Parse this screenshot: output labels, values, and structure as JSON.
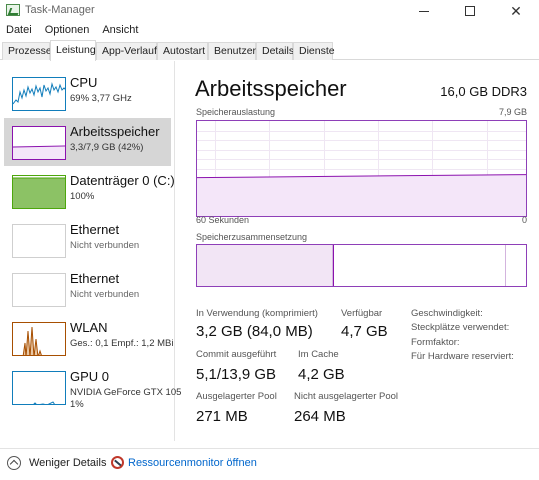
{
  "window": {
    "title": "Task-Manager"
  },
  "menu": [
    "Datei",
    "Optionen",
    "Ansicht"
  ],
  "tabs": [
    "Prozesse",
    "Leistung",
    "App-Verlauf",
    "Autostart",
    "Benutzer",
    "Details",
    "Dienste"
  ],
  "active_tab": "Leistung",
  "sidebar": {
    "items": [
      {
        "name": "CPU",
        "sub": "69% 3,77 GHz",
        "sub2": "",
        "selected": false,
        "color": "#117dbb"
      },
      {
        "name": "Arbeitsspeicher",
        "sub": "3,3/7,9 GB (42%)",
        "sub2": "",
        "selected": true,
        "color": "#8b12ae"
      },
      {
        "name": "Datenträger 0 (C:)",
        "sub": "100%",
        "sub2": "",
        "selected": false,
        "color": "#4da60c"
      },
      {
        "name": "Ethernet",
        "sub": "Nicht verbunden",
        "sub2": "",
        "selected": false,
        "color": "#a74f01"
      },
      {
        "name": "Ethernet",
        "sub": "Nicht verbunden",
        "sub2": "",
        "selected": false,
        "color": "#a74f01"
      },
      {
        "name": "WLAN",
        "sub": "Ges.: 0,1  Empf.: 1,2 MBi",
        "sub2": "",
        "selected": false,
        "color": "#a74f01"
      },
      {
        "name": "GPU 0",
        "sub": "NVIDIA GeForce GTX 105",
        "sub2": "1%",
        "selected": false,
        "color": "#117dbb"
      }
    ]
  },
  "main": {
    "title": "Arbeitsspeicher",
    "spec": "16,0 GB DDR3",
    "usage_label": "Speicherauslastung",
    "usage_max": "7,9 GB",
    "time_left": "60 Sekunden",
    "time_right": "0",
    "composition_label": "Speicherzusammensetzung",
    "usage_fraction": 0.42,
    "stats": {
      "in_use_label": "In Verwendung (komprimiert)",
      "in_use_value": "3,2 GB (84,0 MB)",
      "available_label": "Verfügbar",
      "available_value": "4,7 GB",
      "committed_label": "Commit ausgeführt",
      "committed_value": "5,1/13,9 GB",
      "cached_label": "Im Cache",
      "cached_value": "4,2 GB",
      "paged_label": "Ausgelagerter Pool",
      "paged_value": "271 MB",
      "nonpaged_label": "Nicht ausgelagerter Pool",
      "nonpaged_value": "264 MB"
    },
    "right": {
      "speed": "Geschwindigkeit:",
      "slots": "Steckplätze verwendet:",
      "form": "Formfaktor:",
      "reserved": "Für Hardware reserviert:"
    }
  },
  "footer": {
    "less_details": "Weniger Details",
    "resmon": "Ressourcenmonitor öffnen"
  },
  "colors": {
    "memory_accent": "#8b12ae",
    "cpu_accent": "#117dbb",
    "disk_accent": "#4da60c",
    "net_accent": "#a74f01",
    "link": "#0066cc"
  }
}
